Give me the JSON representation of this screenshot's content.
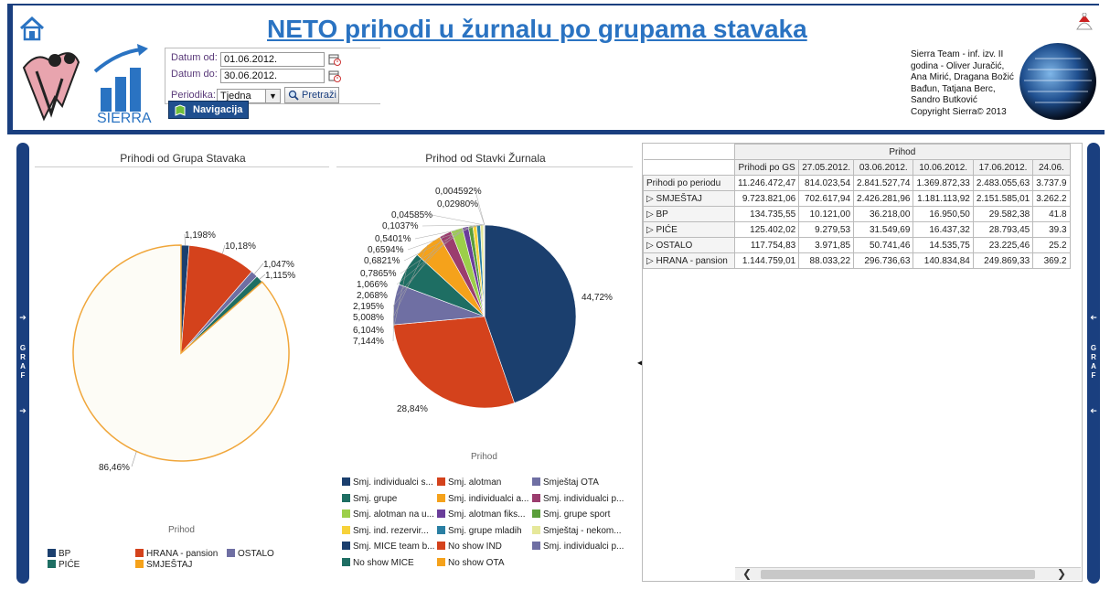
{
  "header": {
    "title": "NETO prihodi u žurnalu po grupama stavaka",
    "logo_text": "SIERRA",
    "credits": [
      "Sierra Team - inf. izv. II",
      "godina - Oliver Juračić,",
      "Ana Mirić, Dragana Božić",
      "Bađun, Tatjana Berc,",
      "Sandro Butković",
      "Copyright Sierra© 2013"
    ]
  },
  "filters": {
    "date_from_label": "Datum od:",
    "date_from_value": "01.06.2012.",
    "date_to_label": "Datum do:",
    "date_to_value": "30.06.2012.",
    "period_label": "Periodika:",
    "period_value": "Tjedna",
    "search_label": "Pretraži",
    "nav_label": "Navigacija"
  },
  "sidebar": {
    "label": "GRAF"
  },
  "chart_left_title": "Prihodi od Grupa Stavaka",
  "chart_right_title": "Prihod od Stavki Žurnala",
  "chart_left_caption": "Prihod",
  "chart_right_caption": "Prihod",
  "colors": {
    "brand": "#1a3f7f",
    "accent": "#2a73c2"
  },
  "chart_data": [
    {
      "type": "pie",
      "title": "Prihodi od Grupa Stavaka",
      "caption": "Prihod",
      "slices": [
        {
          "name": "BP",
          "value": 1.198,
          "label": "1,198%",
          "color": "#1b3f6e"
        },
        {
          "name": "HRANA - pansion",
          "value": 10.18,
          "label": "10,18%",
          "color": "#d4421c"
        },
        {
          "name": "OSTALO",
          "value": 1.047,
          "label": "1,047%",
          "color": "#6f6fa3"
        },
        {
          "name": "PIĆE",
          "value": 1.115,
          "label": "1,115%",
          "color": "#1e6e63"
        },
        {
          "name": "SMJEŠTAJ",
          "value": 86.46,
          "label": "86,46%",
          "color": "#fdfcf6"
        }
      ],
      "legend": [
        {
          "name": "BP",
          "color": "#1b3f6e"
        },
        {
          "name": "HRANA - pansion",
          "color": "#d4421c"
        },
        {
          "name": "OSTALO",
          "color": "#6f6fa3"
        },
        {
          "name": "PIĆE",
          "color": "#1e6e63"
        },
        {
          "name": "SMJEŠTAJ",
          "color": "#f5a21b"
        }
      ]
    },
    {
      "type": "pie",
      "title": "Prihod od Stavki Žurnala",
      "caption": "Prihod",
      "slices": [
        {
          "name": "Smj. individualci s...",
          "value": 44.72,
          "label": "44,72%",
          "color": "#1b3f6e"
        },
        {
          "name": "Smj. alotman",
          "value": 28.84,
          "label": "28,84%",
          "color": "#d4421c"
        },
        {
          "name": "Smještaj OTA",
          "value": 7.144,
          "label": "7,144%",
          "color": "#6f6fa3"
        },
        {
          "name": "Smj. grupe",
          "value": 6.104,
          "label": "6,104%",
          "color": "#1e6e63"
        },
        {
          "name": "Smj. individualci a...",
          "value": 5.008,
          "label": "5,008%",
          "color": "#f5a21b"
        },
        {
          "name": "Smj. individualci p...",
          "value": 2.195,
          "label": "2,195%",
          "color": "#9b3d6e"
        },
        {
          "name": "Smj. alotman na u...",
          "value": 2.068,
          "label": "2,068%",
          "color": "#9ccf4a"
        },
        {
          "name": "Smj. alotman fiks...",
          "value": 1.066,
          "label": "1,066%",
          "color": "#6a3d9a"
        },
        {
          "name": "Smj. grupe sport",
          "value": 0.7865,
          "label": "0,7865%",
          "color": "#5a9e3a"
        },
        {
          "name": "Smj. ind. rezervir...",
          "value": 0.6821,
          "label": "0,6821%",
          "color": "#f7d23a"
        },
        {
          "name": "Smj. grupe mladih",
          "value": 0.6594,
          "label": "0,6594%",
          "color": "#2a7fa3"
        },
        {
          "name": "Smještaj - nekom...",
          "value": 0.5401,
          "label": "0,5401%",
          "color": "#e6e89a"
        },
        {
          "name": "Smj. MICE team b...",
          "value": 0.1037,
          "label": "0,1037%",
          "color": "#1b3f6e"
        },
        {
          "name": "No show IND",
          "value": 0.04585,
          "label": "0,04585%",
          "color": "#d4421c"
        },
        {
          "name": "Smj. individualci p...",
          "value": 0.0298,
          "label": "0,02980%",
          "color": "#6f6fa3"
        },
        {
          "name": "No show MICE",
          "value": 0.004592,
          "label": "0,004592%",
          "color": "#1e6e63"
        },
        {
          "name": "No show OTA",
          "value": 0.003,
          "label": "",
          "color": "#f5a21b"
        }
      ]
    }
  ],
  "table": {
    "group_header": "Prihod",
    "columns": [
      "Prihodi po GS",
      "27.05.2012.",
      "03.06.2012.",
      "10.06.2012.",
      "17.06.2012.",
      "24.06."
    ],
    "rows": [
      {
        "label": "Prihodi po periodu",
        "values": [
          "11.246.472,47",
          "814.023,54",
          "2.841.527,74",
          "1.369.872,33",
          "2.483.055,63",
          "3.737.9"
        ]
      },
      {
        "label": "▷ SMJEŠTAJ",
        "values": [
          "9.723.821,06",
          "702.617,94",
          "2.426.281,96",
          "1.181.113,92",
          "2.151.585,01",
          "3.262.2"
        ]
      },
      {
        "label": "▷ BP",
        "values": [
          "134.735,55",
          "10.121,00",
          "36.218,00",
          "16.950,50",
          "29.582,38",
          "41.8"
        ]
      },
      {
        "label": "▷ PIĆE",
        "values": [
          "125.402,02",
          "9.279,53",
          "31.549,69",
          "16.437,32",
          "28.793,45",
          "39.3"
        ]
      },
      {
        "label": "▷ OSTALO",
        "values": [
          "117.754,83",
          "3.971,85",
          "50.741,46",
          "14.535,75",
          "23.225,46",
          "25.2"
        ]
      },
      {
        "label": "▷ HRANA - pansion",
        "values": [
          "1.144.759,01",
          "88.033,22",
          "296.736,63",
          "140.834,84",
          "249.869,33",
          "369.2"
        ]
      }
    ]
  }
}
